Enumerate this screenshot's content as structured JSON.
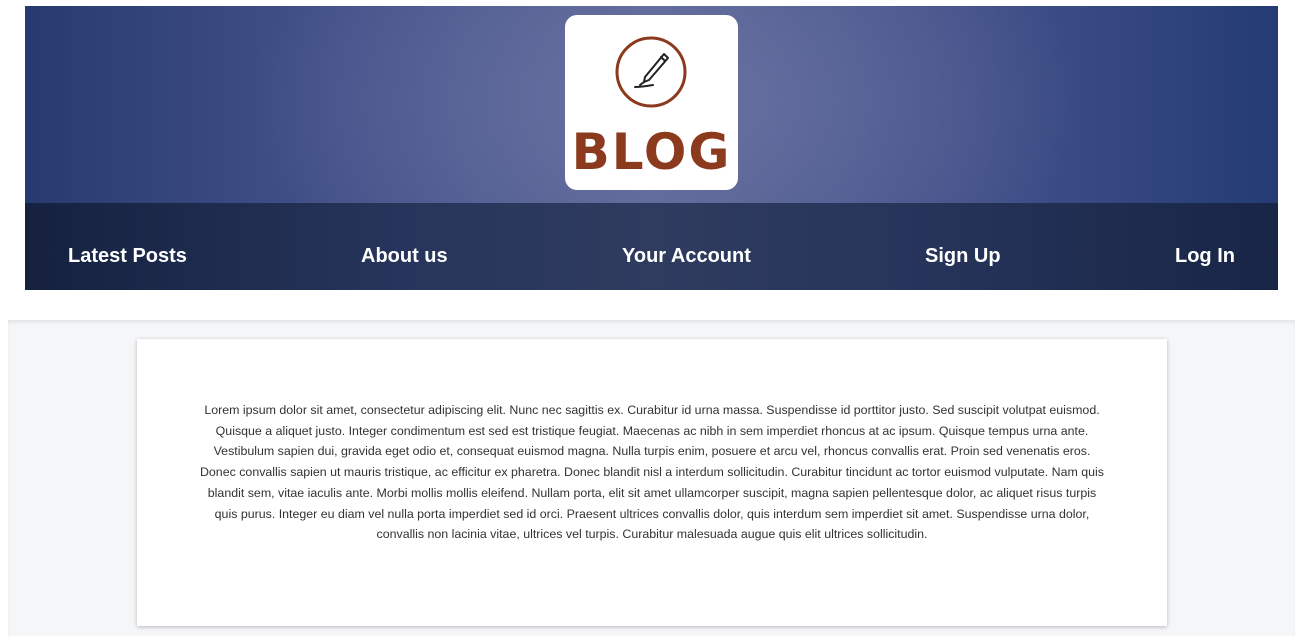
{
  "header": {
    "logo_text": "BLOG",
    "logo_icon": "pen-in-circle-icon",
    "colors": {
      "logo_brown": "#8b3a1e",
      "banner_blue": "#44528a",
      "nav_dark": "#1c2948"
    }
  },
  "nav": {
    "items": [
      {
        "label": "Latest Posts"
      },
      {
        "label": "About us"
      },
      {
        "label": "Your Account"
      },
      {
        "label": "Sign Up"
      },
      {
        "label": "Log In"
      }
    ]
  },
  "main": {
    "body_text": "Lorem ipsum dolor sit amet, consectetur adipiscing elit. Nunc nec sagittis ex. Curabitur id urna massa. Suspendisse id porttitor justo. Sed suscipit volutpat euismod. Quisque a aliquet justo. Integer condimentum est sed est tristique feugiat. Maecenas ac nibh in sem imperdiet rhoncus at ac ipsum. Quisque tempus urna ante. Vestibulum sapien dui, gravida eget odio et, consequat euismod magna. Nulla turpis enim, posuere et arcu vel, rhoncus convallis erat. Proin sed venenatis eros. Donec convallis sapien ut mauris tristique, ac efficitur ex pharetra. Donec blandit nisl a interdum sollicitudin. Curabitur tincidunt ac tortor euismod vulputate. Nam quis blandit sem, vitae iaculis ante. Morbi mollis mollis eleifend. Nullam porta, elit sit amet ullamcorper suscipit, magna sapien pellentesque dolor, ac aliquet risus turpis quis purus. Integer eu diam vel nulla porta imperdiet sed id orci. Praesent ultrices convallis dolor, quis interdum sem imperdiet sit amet. Suspendisse urna dolor, convallis non lacinia vitae, ultrices vel turpis. Curabitur malesuada augue quis elit ultrices sollicitudin."
  }
}
